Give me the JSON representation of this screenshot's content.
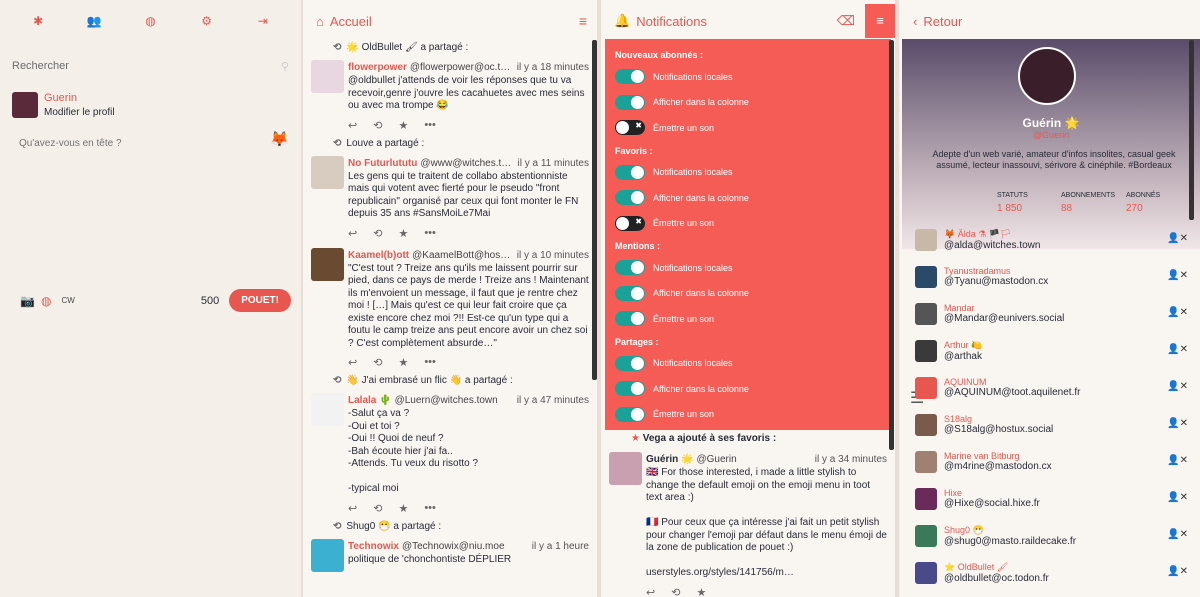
{
  "compose": {
    "nav": [
      "✱",
      "👥",
      "◍",
      "⚙",
      "⇥"
    ],
    "search_placeholder": "Rechercher",
    "account_name": "Guerin",
    "account_edit": "Modifier le profil",
    "textarea_placeholder": "Qu'avez-vous en tête ?",
    "cw": "CW",
    "counter": "500",
    "submit": "POUET!"
  },
  "home": {
    "title": "Accueil",
    "statuses": [
      {
        "boost": "🌟 OldBullet 🖌 a partagé :",
        "dn": "flowerpower",
        "un": "@flowerpower@oc.todon.fr",
        "tm": "il y a 18 minutes",
        "body": "@oldbullet j'attends de voir les réponses que tu va recevoir,genre j'ouvre les cacahuetes avec mes seins ou avec ma trompe 😂",
        "av": "#e8d6e0"
      },
      {
        "boost": "Louve a partagé :",
        "dn": "No Futurlututu",
        "un": "@www@witches.town",
        "tm": "il y a 11 minutes",
        "body": "Les gens qui te traitent de collabo abstentionniste mais qui votent avec fierté pour le pseudo \"front republicain\" organisé par ceux qui font monter le FN depuis 35 ans #SansMoiLe7Mai",
        "av": "#d8ccc0"
      },
      {
        "boost": "",
        "dn": "Kaamel(b)ott",
        "un": "@KaamelBott@hostux.soci…",
        "tm": "il y a 10 minutes",
        "body": "\"C'est tout ? Treize ans qu'ils me laissent pourrir sur pied, dans ce pays de merde ! Treize ans ! Maintenant ils m'envoient un message, il faut que je rentre chez moi ! […] Mais qu'est ce qui leur fait croire que ça existe encore chez moi ?!! Est-ce qu'un type qui a foutu le camp treize ans peut encore avoir un chez soi ? C'est complètement absurde…\"",
        "av": "#6b4a32"
      },
      {
        "boost": "👋 J'ai embrasé un flic 👋 a partagé :",
        "dn": "Lalala 🌵",
        "un": "@Luern@witches.town",
        "tm": "il y a 47 minutes",
        "body": "-Salut ça va ?\n-Oui et toi ?\n-Oui !! Quoi de neuf ?\n-Bah écoute hier j'ai fa..\n-Attends. Tu veux du risotto ?\n\n-typical moi",
        "av": "#f2f2f2"
      },
      {
        "boost": "Shug0 😷 a partagé :",
        "dn": "Technowix",
        "un": "@Technowix@niu.moe",
        "tm": "il y a 1 heure",
        "body": "politique de 'chonchontiste  DÉPLIER",
        "av": "#3cb0d0"
      }
    ]
  },
  "notif": {
    "title": "Notifications",
    "sections": [
      {
        "h": "Nouveaux abonnés :",
        "t": [
          [
            "Notifications locales",
            true
          ],
          [
            "Afficher dans la colonne",
            true
          ],
          [
            "Émettre un son",
            false
          ]
        ]
      },
      {
        "h": "Favoris :",
        "t": [
          [
            "Notifications locales",
            true
          ],
          [
            "Afficher dans la colonne",
            true
          ],
          [
            "Émettre un son",
            false
          ]
        ]
      },
      {
        "h": "Mentions :",
        "t": [
          [
            "Notifications locales",
            true
          ],
          [
            "Afficher dans la colonne",
            true
          ],
          [
            "Émettre un son",
            true
          ]
        ]
      },
      {
        "h": "Partages :",
        "t": [
          [
            "Notifications locales",
            true
          ],
          [
            "Afficher dans la colonne",
            true
          ],
          [
            "Émettre un son",
            true
          ]
        ]
      }
    ],
    "fav_line": "Vega a ajouté à ses favoris :",
    "fav": {
      "dn": "Guérin 🌟",
      "un": "@Guerin",
      "tm": "il y a 34 minutes",
      "body": "🇬🇧 For those interested, i made a little stylish to change the default emoji on the emoji menu in toot text area :)\n\n🇫🇷 Pour ceux que ça intéresse j'ai fait un petit stylish pour changer l'emoji par défaut dans le menu émoji de la zone de publication de pouet :)\n\nuserstyles.org/styles/141756/m…"
    }
  },
  "profile": {
    "back": "Retour",
    "name": "Guérin 🌟",
    "handle": "@Guerin",
    "bio": "Adepte d'un web varié, amateur d'infos insolites, casual geek assumé, lecteur inassouvi, sérivore & cinéphile. #Bordeaux",
    "stats": [
      [
        "STATUTS",
        "1 850"
      ],
      [
        "ABONNEMENTS",
        "88"
      ],
      [
        "ABONNÉS",
        "270"
      ]
    ],
    "follows": [
      [
        "🦊 Älda ⚗ 🏴🏳",
        "@alda@witches.town",
        "#c8b8a8"
      ],
      [
        "Tyanustradamus",
        "@Tyanu@mastodon.cx",
        "#2b4a6a"
      ],
      [
        "Mandar",
        "@Mandar@eunivers.social",
        "#555"
      ],
      [
        "Arthur 🍋",
        "@arthak",
        "#3a3a3a"
      ],
      [
        "AQUINUM",
        "@AQUINUM@toot.aquilenet.fr",
        "#e8574f"
      ],
      [
        "S18alg",
        "@S18alg@hostux.social",
        "#7a5a4a"
      ],
      [
        "Marine van Bitburg",
        "@m4rine@mastodon.cx",
        "#a08070"
      ],
      [
        "Hixe",
        "@Hixe@social.hixe.fr",
        "#6a2a5a"
      ],
      [
        "Shug0 😷",
        "@shug0@masto.raildecake.fr",
        "#3a7a5a"
      ],
      [
        "⭐ OldBullet 🖌",
        "@oldbullet@oc.todon.fr",
        "#4a4a8a"
      ]
    ]
  }
}
